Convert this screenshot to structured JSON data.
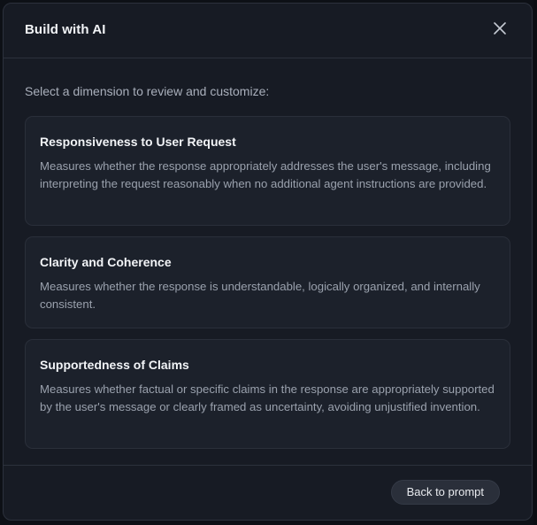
{
  "modal": {
    "title": "Build with AI",
    "close_icon": "close-icon",
    "intro": "Select a dimension to review and customize:"
  },
  "dimensions": [
    {
      "title": "Responsiveness to User Request",
      "description": "Measures whether the response appropriately addresses the user's message, including interpreting the request reasonably when no additional agent instructions are provided."
    },
    {
      "title": "Clarity and Coherence",
      "description": "Measures whether the response is understandable, logically organized, and internally consistent."
    },
    {
      "title": "Supportedness of Claims",
      "description": "Measures whether factual or specific claims in the response are appropriately supported by the user's message or clearly framed as uncertainty, avoiding unjustified invention."
    }
  ],
  "footer": {
    "back_label": "Back to prompt"
  },
  "colors": {
    "modal_bg": "#171b24",
    "card_bg": "#1c212b",
    "border": "#2c313c",
    "title_text": "#f2f4f7",
    "body_text": "#9aa1ad"
  }
}
